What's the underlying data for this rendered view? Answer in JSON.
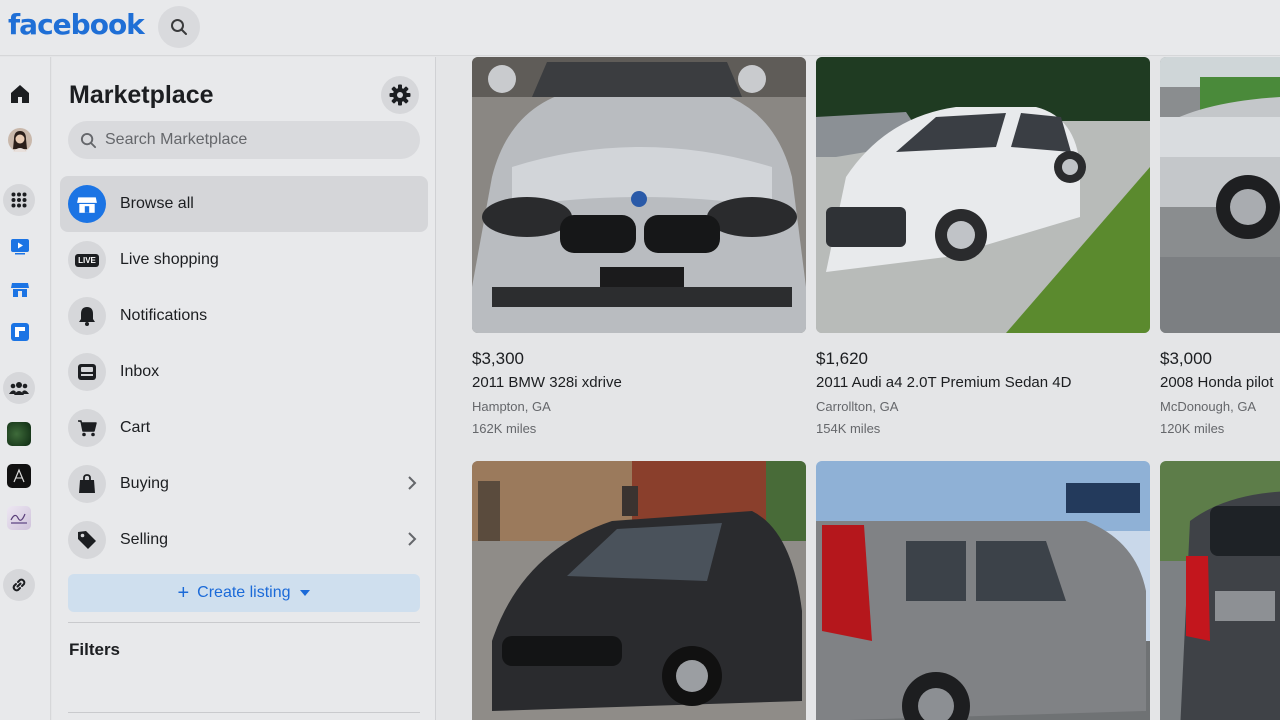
{
  "brand": {
    "logo": "facebook"
  },
  "sidebar": {
    "title": "Marketplace",
    "search_placeholder": "Search Marketplace",
    "items": [
      {
        "label": "Browse all",
        "icon": "storefront-icon",
        "active": true
      },
      {
        "label": "Live shopping",
        "icon": "live-icon"
      },
      {
        "label": "Notifications",
        "icon": "bell-icon"
      },
      {
        "label": "Inbox",
        "icon": "inbox-icon"
      },
      {
        "label": "Cart",
        "icon": "cart-icon"
      },
      {
        "label": "Buying",
        "icon": "shopping-bag-icon",
        "has_chevron": true
      },
      {
        "label": "Selling",
        "icon": "price-tag-icon",
        "has_chevron": true
      }
    ],
    "create_listing": "Create listing",
    "filters_heading": "Filters",
    "live_badge": "LIVE"
  },
  "listings": [
    {
      "price": "$3,300",
      "title": "2011 BMW 328i xdrive",
      "location": "Hampton, GA",
      "miles": "162K miles"
    },
    {
      "price": "$1,620",
      "title": "2011 Audi a4 2.0T Premium Sedan 4D",
      "location": "Carrollton, GA",
      "miles": "154K miles"
    },
    {
      "price": "$3,000",
      "title": "2008 Honda pilot",
      "location": "McDonough, GA",
      "miles": "120K miles"
    }
  ],
  "colors": {
    "brand_blue": "#1b74e4",
    "accent_link": "#1b6ad8"
  }
}
